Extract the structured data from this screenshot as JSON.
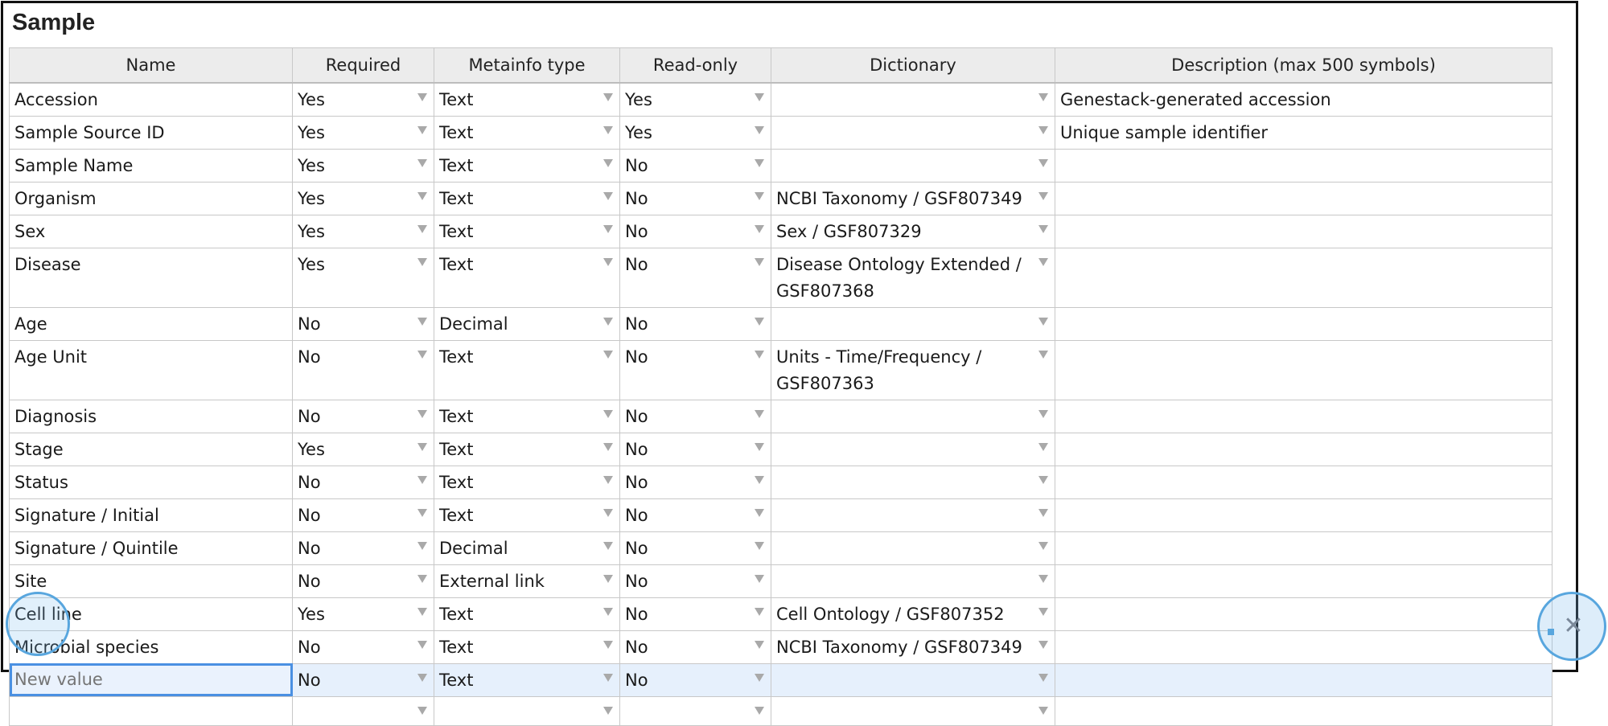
{
  "page": {
    "title": "Sample"
  },
  "table": {
    "headers": [
      "Name",
      "Required",
      "Metainfo type",
      "Read-only",
      "Dictionary",
      "Description (max 500 symbols)"
    ],
    "rows": [
      {
        "name": "Accession",
        "required": "Yes",
        "type": "Text",
        "readonly": "Yes",
        "dictionary": "",
        "description": "Genestack-generated accession"
      },
      {
        "name": "Sample Source ID",
        "required": "Yes",
        "type": "Text",
        "readonly": "Yes",
        "dictionary": "",
        "description": "Unique sample identifier"
      },
      {
        "name": "Sample Name",
        "required": "Yes",
        "type": "Text",
        "readonly": "No",
        "dictionary": "",
        "description": ""
      },
      {
        "name": "Organism",
        "required": "Yes",
        "type": "Text",
        "readonly": "No",
        "dictionary": "NCBI Taxonomy / GSF807349",
        "description": ""
      },
      {
        "name": "Sex",
        "required": "Yes",
        "type": "Text",
        "readonly": "No",
        "dictionary": "Sex / GSF807329",
        "description": ""
      },
      {
        "name": "Disease",
        "required": "Yes",
        "type": "Text",
        "readonly": "No",
        "dictionary": "Disease Ontology Extended / GSF807368",
        "description": ""
      },
      {
        "name": "Age",
        "required": "No",
        "type": "Decimal",
        "readonly": "No",
        "dictionary": "",
        "description": ""
      },
      {
        "name": "Age Unit",
        "required": "No",
        "type": "Text",
        "readonly": "No",
        "dictionary": "Units - Time/Frequency / GSF807363",
        "description": ""
      },
      {
        "name": "Diagnosis",
        "required": "No",
        "type": "Text",
        "readonly": "No",
        "dictionary": "",
        "description": ""
      },
      {
        "name": "Stage",
        "required": "Yes",
        "type": "Text",
        "readonly": "No",
        "dictionary": "",
        "description": ""
      },
      {
        "name": "Status",
        "required": "No",
        "type": "Text",
        "readonly": "No",
        "dictionary": "",
        "description": ""
      },
      {
        "name": "Signature / Initial",
        "required": "No",
        "type": "Text",
        "readonly": "No",
        "dictionary": "",
        "description": ""
      },
      {
        "name": "Signature / Quintile",
        "required": "No",
        "type": "Decimal",
        "readonly": "No",
        "dictionary": "",
        "description": ""
      },
      {
        "name": "Site",
        "required": "No",
        "type": "External link",
        "readonly": "No",
        "dictionary": "",
        "description": ""
      },
      {
        "name": "Cell line",
        "required": "Yes",
        "type": "Text",
        "readonly": "No",
        "dictionary": "Cell Ontology / GSF807352",
        "description": ""
      },
      {
        "name": "Microbial species",
        "required": "No",
        "type": "Text",
        "readonly": "No",
        "dictionary": "NCBI Taxonomy / GSF807349",
        "description": ""
      }
    ],
    "new_row": {
      "placeholder": "New value",
      "required": "No",
      "type": "Text",
      "readonly": "No",
      "dictionary": "",
      "description": ""
    },
    "empty_row": {
      "required": "",
      "type": "",
      "readonly": "",
      "dictionary": ""
    }
  },
  "icons": {
    "dropdown": "chevron-down-icon",
    "delete": "close-icon"
  },
  "colors": {
    "selected_row": "#e6f0fc",
    "focus_border": "#4a90e2",
    "header_bg": "#ececec"
  }
}
